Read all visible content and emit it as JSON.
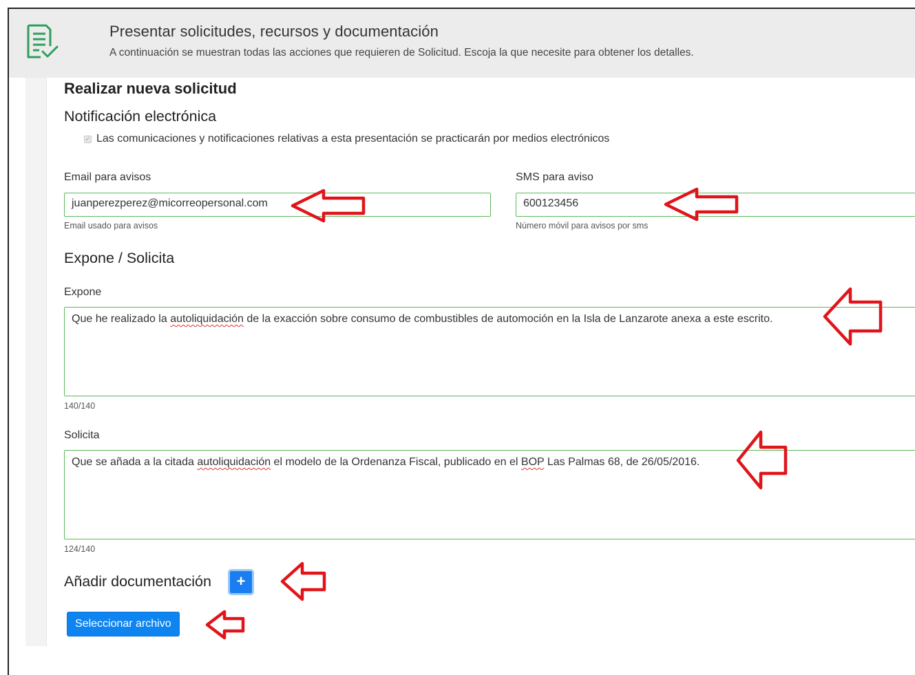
{
  "header": {
    "title": "Presentar solicitudes, recursos y documentación",
    "subtitle": "A continuación se muestran todas las acciones que requieren de Solicitud. Escoja la que necesite para obtener los detalles.",
    "icon": "document-check-icon",
    "icon_color": "#2e9e5b"
  },
  "form": {
    "heading": "Realizar nueva solicitud",
    "notification": {
      "heading": "Notificación electrónica",
      "checkbox_label": "Las comunicaciones y notificaciones relativas a esta presentación se practicarán por medios electrónicos",
      "checked": true
    },
    "email": {
      "label": "Email para avisos",
      "value": "juanperezperez@micorreopersonal.com",
      "help": "Email usado para avisos"
    },
    "sms": {
      "label": "SMS para aviso",
      "value": "600123456",
      "help": "Número móvil para avisos por sms"
    },
    "expone_solicita": {
      "heading": "Expone / Solicita",
      "expone": {
        "label": "Expone",
        "text_before": "Que he realizado la ",
        "text_misspelled": "autoliquidación",
        "text_after": " de la exacción sobre consumo de combustibles de automoción en la Isla de Lanzarote anexa a este escrito.",
        "counter": "140/140"
      },
      "solicita": {
        "label": "Solicita",
        "text_before": "Que se añada a la citada ",
        "text_misspelled_1": "autoliquidación",
        "text_middle": " el modelo de la Ordenanza Fiscal, publicado en el ",
        "text_misspelled_2": "BOP",
        "text_after": " Las Palmas 68, de 26/05/2016.",
        "counter": "124/140"
      }
    },
    "documentation": {
      "heading": "Añadir documentación",
      "add_button_label": "+",
      "select_file_label": "Seleccionar archivo"
    }
  },
  "colors": {
    "input_border": "#5cb85c",
    "primary_button": "#0d84f0",
    "annotation_arrow": "#e0141a",
    "header_bg": "#ececec"
  }
}
